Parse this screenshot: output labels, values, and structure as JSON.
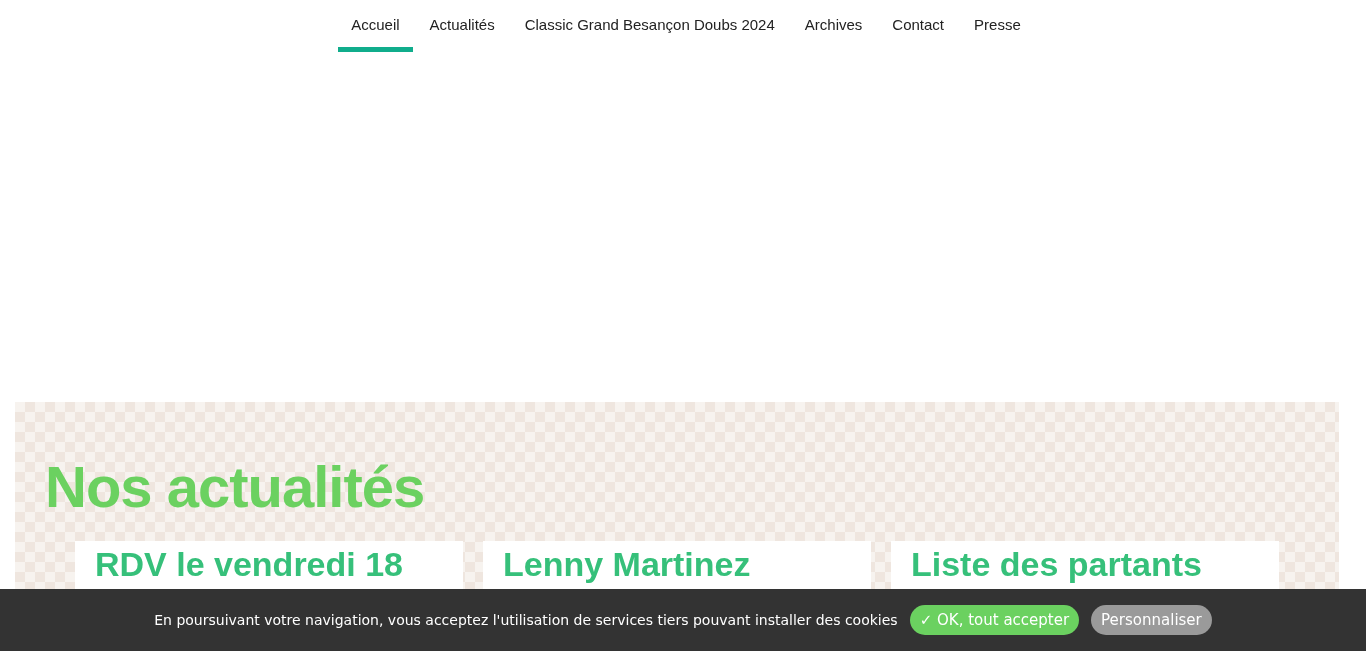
{
  "nav": {
    "items": [
      {
        "label": "Accueil",
        "selected": true
      },
      {
        "label": "Actualités",
        "selected": false
      },
      {
        "label": "Classic Grand Besançon Doubs 2024",
        "selected": false
      },
      {
        "label": "Archives",
        "selected": false
      },
      {
        "label": "Contact",
        "selected": false
      },
      {
        "label": "Presse",
        "selected": false
      }
    ]
  },
  "news": {
    "heading": "Nos actualités",
    "cards": [
      {
        "title": "RDV le vendredi 18"
      },
      {
        "title": "Lenny Martinez"
      },
      {
        "title": "Liste des partants"
      }
    ]
  },
  "cookie_bar": {
    "message": "En poursuivant votre navigation, vous acceptez l'utilisation de services tiers pouvant installer des cookies",
    "accept_button": "✓ OK, tout accepter",
    "customize_button": "Personnaliser"
  }
}
